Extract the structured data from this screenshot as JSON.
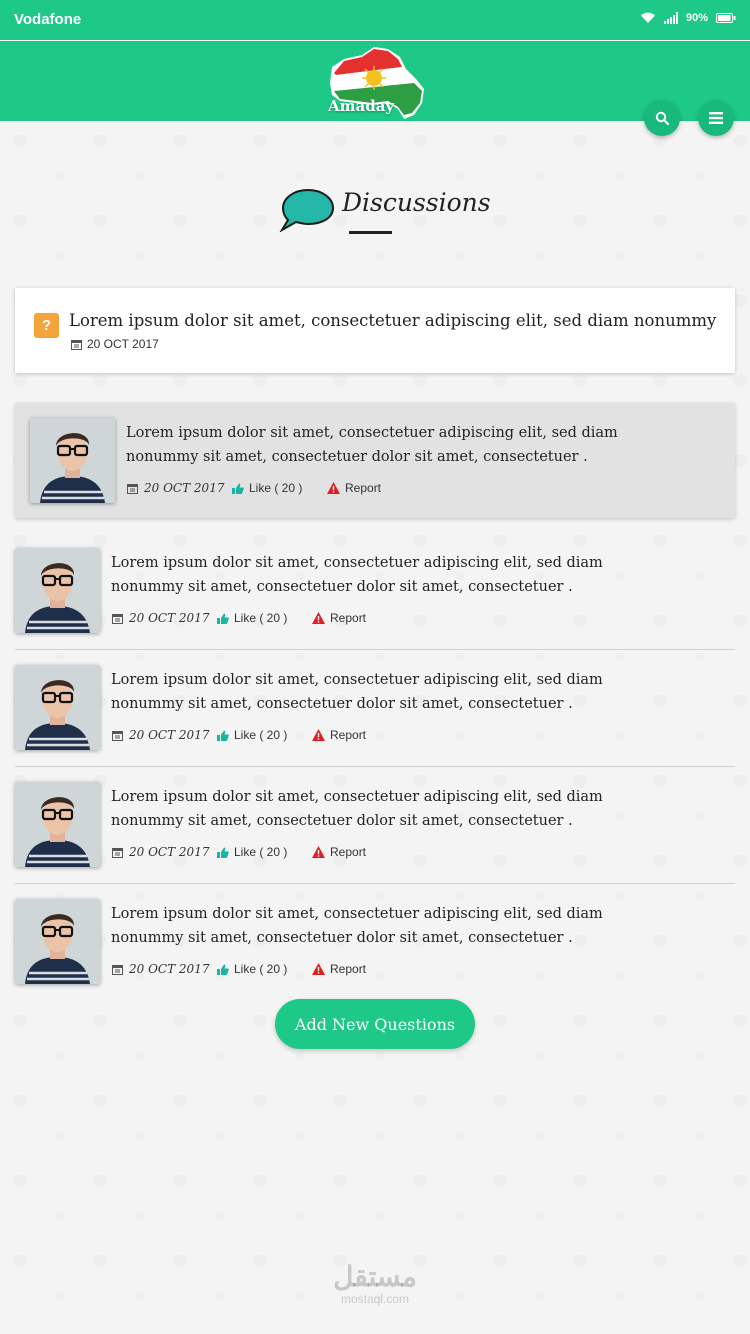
{
  "status_bar": {
    "carrier": "Vodafone",
    "battery": "90%"
  },
  "header": {
    "logo_text": "Amaday"
  },
  "page": {
    "title": "Discussions"
  },
  "question": {
    "badge": "?",
    "text": "Lorem ipsum dolor sit amet, consectetuer adipiscing elit, sed diam nonummy",
    "date": "20  OCT 2017"
  },
  "answers": [
    {
      "text": "Lorem ipsum dolor sit amet, consectetuer adipiscing elit, sed diam nonummy sit amet, consectetuer  dolor sit amet, consectetuer .",
      "date": "20  OCT 2017",
      "like_label": "Like ( 20 )",
      "report_label": "Report",
      "highlighted": true
    },
    {
      "text": "Lorem ipsum dolor sit amet, consectetuer adipiscing elit, sed diam nonummy sit amet, consectetuer  dolor sit amet, consectetuer .",
      "date": "20  OCT 2017",
      "like_label": "Like ( 20 )",
      "report_label": "Report"
    },
    {
      "text": "Lorem ipsum dolor sit amet, consectetuer adipiscing elit, sed diam nonummy sit amet, consectetuer  dolor sit amet, consectetuer .",
      "date": "20  OCT 2017",
      "like_label": "Like ( 20 )",
      "report_label": "Report"
    },
    {
      "text": "Lorem ipsum dolor sit amet, consectetuer adipiscing elit, sed diam nonummy sit amet, consectetuer  dolor sit amet, consectetuer .",
      "date": "20  OCT 2017",
      "like_label": "Like ( 20 )",
      "report_label": "Report"
    },
    {
      "text": "Lorem ipsum dolor sit amet, consectetuer adipiscing elit, sed diam nonummy sit amet, consectetuer  dolor sit amet, consectetuer .",
      "date": "20  OCT 2017",
      "like_label": "Like ( 20 )",
      "report_label": "Report"
    }
  ],
  "add_button": {
    "label": "Add New Questions"
  },
  "watermark": {
    "arabic": "مستقل",
    "latin": "mostaql.com"
  },
  "colors": {
    "brand": "#1ec886",
    "badge": "#f4a43c",
    "report": "#e02020",
    "like": "#1ab3a6"
  }
}
